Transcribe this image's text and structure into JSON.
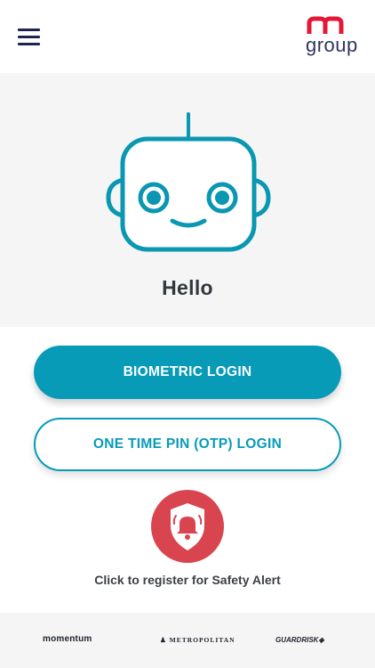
{
  "header": {
    "menu_icon": "hamburger-menu-icon",
    "logo": {
      "text": "group",
      "color": "#e31837"
    }
  },
  "hero": {
    "illustration": "robot-face-icon",
    "greeting": "Hello"
  },
  "actions": {
    "biometric_label": "BIOMETRIC LOGIN",
    "otp_label": "ONE TIME PIN (OTP) LOGIN"
  },
  "safety": {
    "icon": "shield-bell-icon",
    "label": "Click to register for Safety Alert"
  },
  "footer": {
    "brands": [
      "momentum",
      "METROPOLITAN",
      "GUARDRISK"
    ]
  },
  "colors": {
    "accent": "#079bb8",
    "alert": "#d9454e",
    "navy": "#1e2452",
    "background_gray": "#f5f5f5"
  }
}
